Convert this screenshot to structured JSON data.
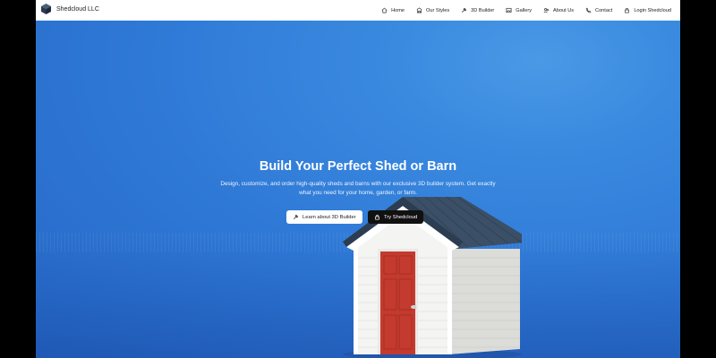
{
  "brand": {
    "name": "Shedcloud LLC",
    "logo_icon": "cube-logo-icon"
  },
  "nav": [
    {
      "label": "Home",
      "icon": "home-icon"
    },
    {
      "label": "Our Styles",
      "icon": "building-icon"
    },
    {
      "label": "3D Builder",
      "icon": "tool-icon"
    },
    {
      "label": "Gallery",
      "icon": "image-icon"
    },
    {
      "label": "About Us",
      "icon": "users-icon"
    },
    {
      "label": "Contact",
      "icon": "phone-icon"
    },
    {
      "label": "Login Shedcloud",
      "icon": "lock-icon"
    }
  ],
  "hero": {
    "title": "Build Your Perfect Shed or Barn",
    "subtitle": "Design, customize, and order high-quality sheds and barns with our exclusive 3D builder system. Get exactly what you need for your home, garden, or farm.",
    "primary_button": "Learn about 3D Builder",
    "secondary_button": "Try Shedcloud"
  },
  "colors": {
    "hero_blue": "#2f7ad6",
    "door_red": "#c43a2e",
    "roof": "#3b4f66",
    "siding": "#f4f4f2"
  }
}
